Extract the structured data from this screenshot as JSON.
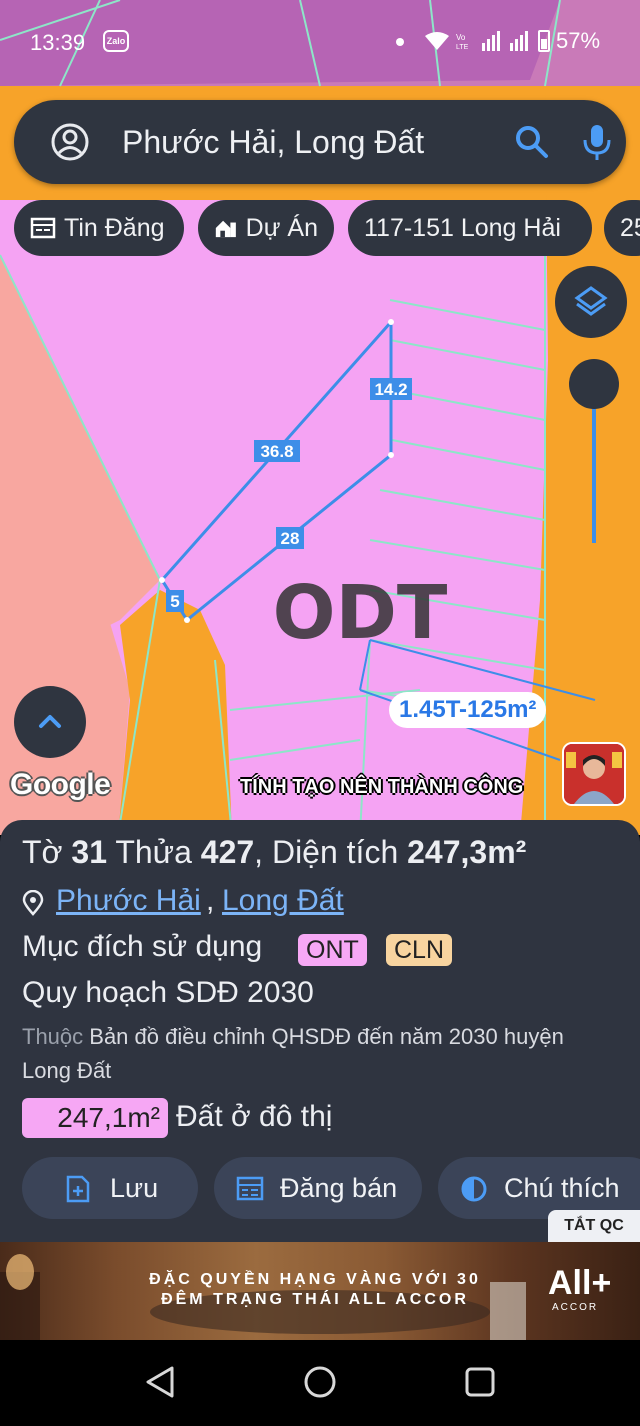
{
  "status_bar": {
    "time": "13:39",
    "notification_app": "Zalo",
    "battery": "57%",
    "icons": [
      "dot-icon",
      "wifi-icon",
      "volte-icon",
      "signal-icon",
      "signal-icon",
      "battery-icon"
    ]
  },
  "search": {
    "query": "Phước Hải, Long Đất",
    "icons": [
      "account-icon",
      "search-icon",
      "mic-icon"
    ]
  },
  "chips": [
    {
      "label": "Tin Đăng",
      "icon": "listing-icon"
    },
    {
      "label": "Dự Án",
      "icon": "project-icon"
    },
    {
      "label": "117-151 Long Hải",
      "icon": ""
    },
    {
      "label": "25",
      "icon": ""
    }
  ],
  "map": {
    "zone_label": "ODT",
    "edge_labels": [
      "14.2",
      "36.8",
      "28",
      "5"
    ],
    "area_tag": "1.45T-125m²",
    "attribution": "Google",
    "ticker": "TÍNH TẠO NÊN THÀNH CÔNG",
    "colors": {
      "residential": "#f5a3f3",
      "land_salmon": "#f8a7a0",
      "road_orange": "#f7a329",
      "boundary_blue": "#3d8ee8",
      "lot_lines": "#8de6c8"
    }
  },
  "parcel": {
    "prefix_to": "Tờ ",
    "sheet": "31",
    "prefix_thua": " Thửa ",
    "lot": "427",
    "prefix_area": ", Diện tích ",
    "area": "247,3m²",
    "location_ward": "Phước Hải",
    "location_comma": ",",
    "location_district": "Long Đất",
    "usage_label": "Mục đích sử dụng",
    "usage_codes": [
      {
        "code": "ONT",
        "color": "#f7a8f5"
      },
      {
        "code": "CLN",
        "color": "#f8d49f"
      }
    ],
    "plan_title": "Quy hoạch SDĐ 2030",
    "plan_desc_muted": "Thuộc",
    "plan_desc": " Bản đồ điều chỉnh QHSDĐ đến năm 2030 huyện Long Đất",
    "plan_area": "247,1m²",
    "plan_area_type": "Đất ở đô thị"
  },
  "actions": [
    {
      "label": "Lưu",
      "icon": "save-icon"
    },
    {
      "label": "Đăng bán",
      "icon": "calendar-icon"
    },
    {
      "label": "Chú thích",
      "icon": "legend-icon"
    }
  ],
  "ad": {
    "close_label": "TẮT QC",
    "headline": "ĐẶC QUYỀN HẠNG VÀNG VỚI 30 ĐÊM TRẠNG THÁI ALL ACCOR",
    "brand": "All+",
    "brand_sub": "ACCOR"
  },
  "nav": {
    "icons": [
      "back-icon",
      "home-icon",
      "recents-icon"
    ]
  }
}
